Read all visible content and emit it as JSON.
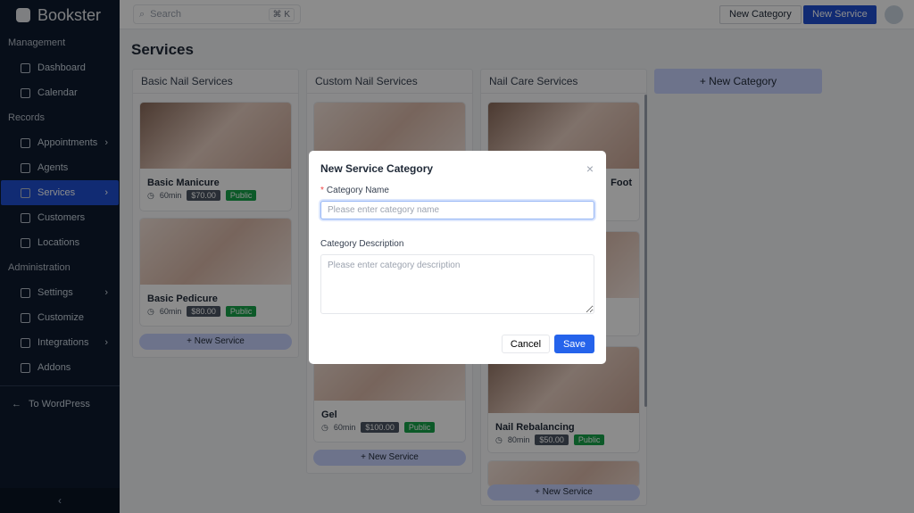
{
  "app": {
    "name": "Bookster"
  },
  "sidebar": {
    "sections": [
      {
        "label": "Management",
        "items": [
          {
            "label": "Dashboard",
            "icon": "gauge-icon"
          },
          {
            "label": "Calendar",
            "icon": "calendar-icon"
          }
        ]
      },
      {
        "label": "Records",
        "items": [
          {
            "label": "Appointments",
            "icon": "clipboard-icon",
            "chevron": true
          },
          {
            "label": "Agents",
            "icon": "users-icon"
          },
          {
            "label": "Services",
            "icon": "box-icon",
            "chevron": true,
            "active": true
          },
          {
            "label": "Customers",
            "icon": "user-card-icon"
          },
          {
            "label": "Locations",
            "icon": "map-pin-icon"
          }
        ]
      },
      {
        "label": "Administration",
        "items": [
          {
            "label": "Settings",
            "icon": "gear-icon",
            "chevron": true
          },
          {
            "label": "Customize",
            "icon": "sliders-icon"
          },
          {
            "label": "Integrations",
            "icon": "share-icon",
            "chevron": true
          },
          {
            "label": "Addons",
            "icon": "puzzle-icon"
          }
        ]
      }
    ],
    "to_wordpress": "To WordPress",
    "collapse": "‹"
  },
  "topbar": {
    "search_placeholder": "Search",
    "shortcut": "⌘ K",
    "new_category": "New Category",
    "new_service": "New Service"
  },
  "page": {
    "title": "Services",
    "new_category": "+ New Category",
    "new_service": "+ New Service"
  },
  "columns": [
    {
      "name": "Basic Nail Services",
      "cards": [
        {
          "name": "Basic Manicure",
          "duration": "60min",
          "price": "$70.00",
          "status": "Public"
        },
        {
          "name": "Basic Pedicure",
          "duration": "60min",
          "price": "$80.00",
          "status": "Public"
        }
      ]
    },
    {
      "name": "Custom Nail Services",
      "cards": [
        {
          "name": "Gel",
          "duration": "60min",
          "price": "$100.00",
          "status": "Public"
        }
      ]
    },
    {
      "name": "Nail Care Services",
      "cards": [
        {
          "name": "Foot"
        },
        {
          "name": "Nail Rebalancing",
          "duration": "80min",
          "price": "$50.00",
          "status": "Public"
        }
      ]
    }
  ],
  "modal": {
    "title": "New Service Category",
    "name_label": "Category Name",
    "name_placeholder": "Please enter category name",
    "desc_label": "Category Description",
    "desc_placeholder": "Please enter category description",
    "cancel": "Cancel",
    "save": "Save",
    "close": "×"
  },
  "colors": {
    "accent": "#1f4fd1",
    "public": "#16a34a",
    "sidebar": "#0d1b2e"
  }
}
